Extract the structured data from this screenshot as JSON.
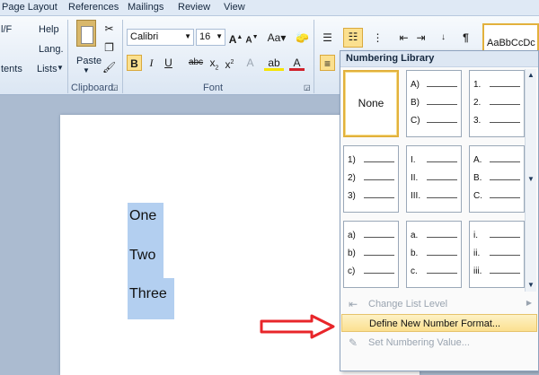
{
  "tabs": [
    "Page Layout",
    "References",
    "Mailings",
    "Review",
    "View"
  ],
  "ribbon": {
    "left_partial": {
      "line1": "l/F",
      "line2": "tents"
    },
    "help": "Help",
    "lang": "Lang.",
    "lists": "Lists",
    "paste": "Paste",
    "font_name": "Calibri",
    "font_size": "16",
    "clipboard_label": "Clipboard",
    "font_label": "Font",
    "style_preview": "AaBbCcDc"
  },
  "document": {
    "lines": [
      "One",
      "Two",
      "Three"
    ]
  },
  "menu": {
    "header": "Numbering Library",
    "none_label": "None",
    "tiles": [
      {
        "items": [
          "A)",
          "B)",
          "C)"
        ]
      },
      {
        "items": [
          "1.",
          "2.",
          "3."
        ]
      },
      {
        "items": [
          "1)",
          "2)",
          "3)"
        ]
      },
      {
        "items": [
          "I.",
          "II.",
          "III."
        ]
      },
      {
        "items": [
          "A.",
          "B.",
          "C."
        ]
      },
      {
        "items": [
          "a)",
          "b)",
          "c)"
        ]
      },
      {
        "items": [
          "a.",
          "b.",
          "c."
        ]
      },
      {
        "items": [
          "i.",
          "ii.",
          "iii."
        ]
      }
    ],
    "change_level": "Change List Level",
    "define_format": "Define New Number Format...",
    "set_value": "Set Numbering Value..."
  },
  "colors": {
    "highlight": "#b3cff0",
    "arrow": "#e8262a",
    "menu_hover": "#fbe08f"
  }
}
